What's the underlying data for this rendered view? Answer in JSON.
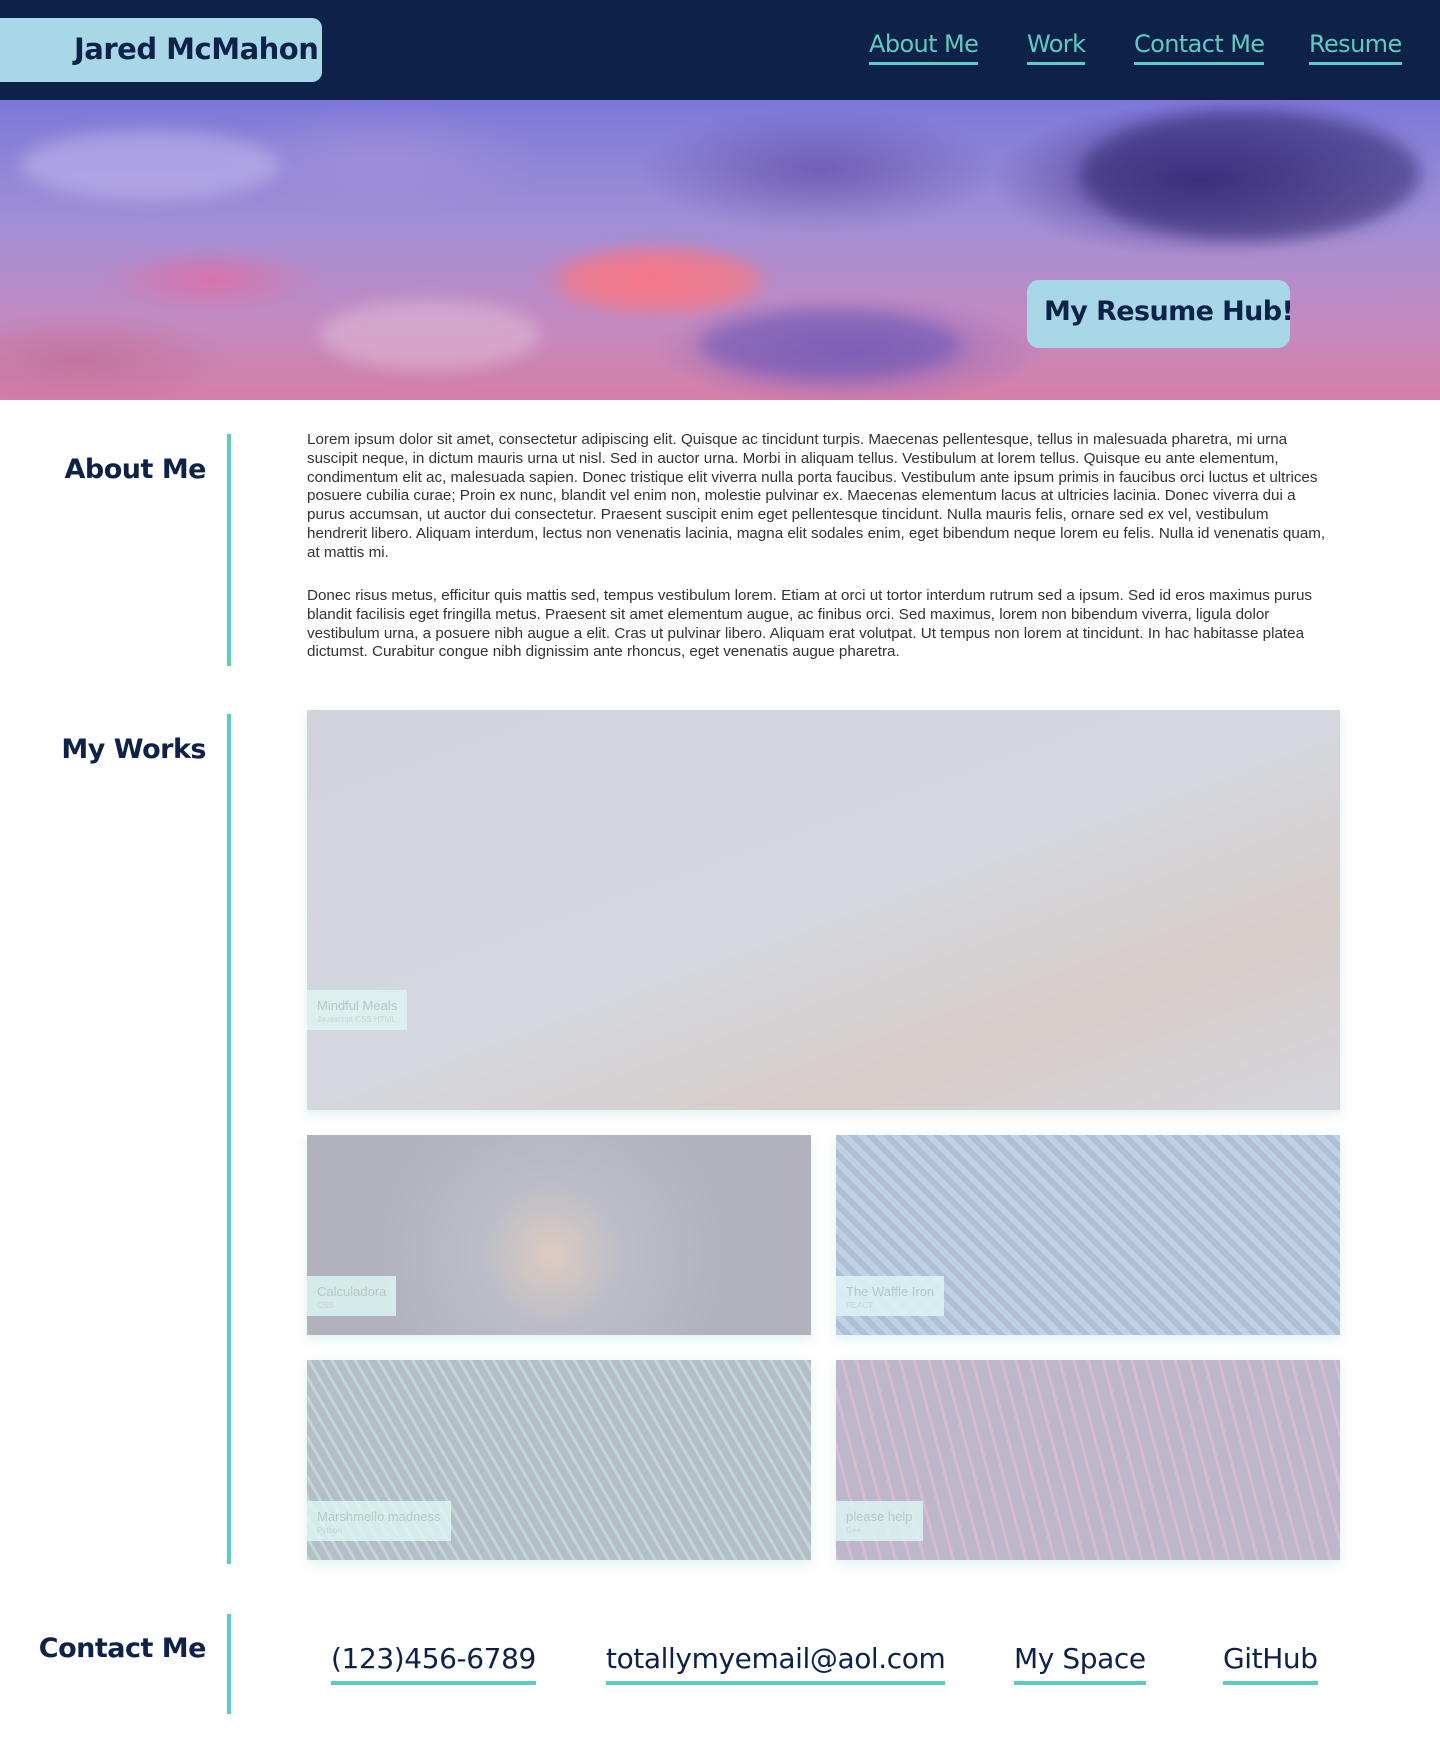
{
  "header": {
    "brand": "Jared McMahon",
    "nav": [
      "About Me",
      "Work",
      "Contact Me",
      "Resume"
    ]
  },
  "hero": {
    "badge": "My Resume Hub!"
  },
  "about": {
    "title": "About Me",
    "paragraphs": [
      "Lorem ipsum dolor sit amet, consectetur adipiscing elit. Quisque ac tincidunt turpis. Maecenas pellentesque, tellus in malesuada pharetra, mi urna suscipit neque, in dictum mauris urna ut nisl. Sed in auctor urna. Morbi in aliquam tellus. Vestibulum at lorem tellus. Quisque eu ante elementum, condimentum elit ac, malesuada sapien. Donec tristique elit viverra nulla porta faucibus. Vestibulum ante ipsum primis in faucibus orci luctus et ultrices posuere cubilia curae; Proin ex nunc, blandit vel enim non, molestie pulvinar ex. Maecenas elementum lacus at ultricies lacinia. Donec viverra dui a purus accumsan, ut auctor dui consectetur. Praesent suscipit enim eget pellentesque tincidunt. Nulla mauris felis, ornare sed ex vel, vestibulum hendrerit libero. Aliquam interdum, lectus non venenatis lacinia, magna elit sodales enim, eget bibendum neque lorem eu felis. Nulla id venenatis quam, at mattis mi.",
      "Donec risus metus, efficitur quis mattis sed, tempus vestibulum lorem. Etiam at orci ut tortor interdum rutrum sed a ipsum. Sed id eros maximus purus blandit facilisis eget fringilla metus. Praesent sit amet elementum augue, ac finibus orci. Sed maximus, lorem non bibendum viverra, ligula dolor vestibulum urna, a posuere nibh augue a elit. Cras ut pulvinar libero. Aliquam erat volutpat. Ut tempus non lorem at tincidunt. In hac habitasse platea dictumst. Curabitur congue nibh dignissim ante rhoncus, eget venenatis augue pharetra."
    ]
  },
  "works": {
    "title": "My Works",
    "items": [
      {
        "title": "Mindful Meals",
        "subtitle": "Javascript CSS HTML"
      },
      {
        "title": "Calculadora",
        "subtitle": "CSS"
      },
      {
        "title": "The Waffle Iron",
        "subtitle": "REACT"
      },
      {
        "title": "Marshmello madness",
        "subtitle": "Python"
      },
      {
        "title": "please help",
        "subtitle": "C++"
      }
    ]
  },
  "contact": {
    "title": "Contact Me",
    "links": [
      "(123)456-6789",
      "totallymyemail@aol.com",
      "My Space",
      "GitHub"
    ]
  },
  "colors": {
    "navy": "#0d2149",
    "teal": "#5ecbc3",
    "light_blue": "#a8d8e7"
  }
}
